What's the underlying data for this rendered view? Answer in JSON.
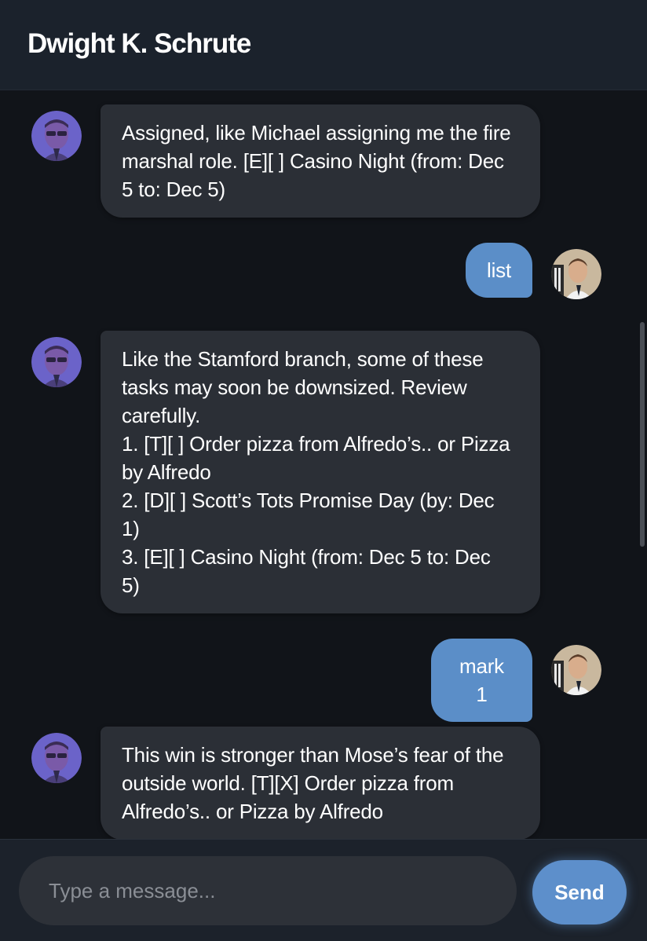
{
  "header": {
    "title": "Dwight K. Schrute"
  },
  "messages": [
    {
      "sender": "bot",
      "lines": [
        "Assigned, like Michael assigning me the fire",
        "marshal role. [E][ ] Casino Night (from: Dec",
        "5 to: Dec 5)"
      ]
    },
    {
      "sender": "user",
      "text": "list"
    },
    {
      "sender": "bot",
      "lines": [
        "Like the Stamford branch, some of these",
        "tasks may soon be downsized. Review",
        "carefully.",
        "1. [T][ ] Order pizza from Alfredo’s.. or Pizza",
        "by Alfredo",
        "2. [D][ ] Scott’s Tots Promise Day (by: Dec",
        "1)",
        "3. [E][ ] Casino Night (from: Dec 5 to: Dec",
        "5)"
      ]
    },
    {
      "sender": "user",
      "text": "mark 1"
    },
    {
      "sender": "bot",
      "lines": [
        "This win is stronger than Mose’s fear of the",
        "outside world. [T][X] Order pizza from",
        "Alfredo’s.. or Pizza by Alfredo"
      ]
    }
  ],
  "composer": {
    "placeholder": "Type a message...",
    "value": "",
    "send_label": "Send"
  },
  "colors": {
    "bot_bubble": "#2b2f36",
    "user_bubble": "#5b8ec8",
    "send_button": "#5d8fcb",
    "header": "#1b222c"
  }
}
